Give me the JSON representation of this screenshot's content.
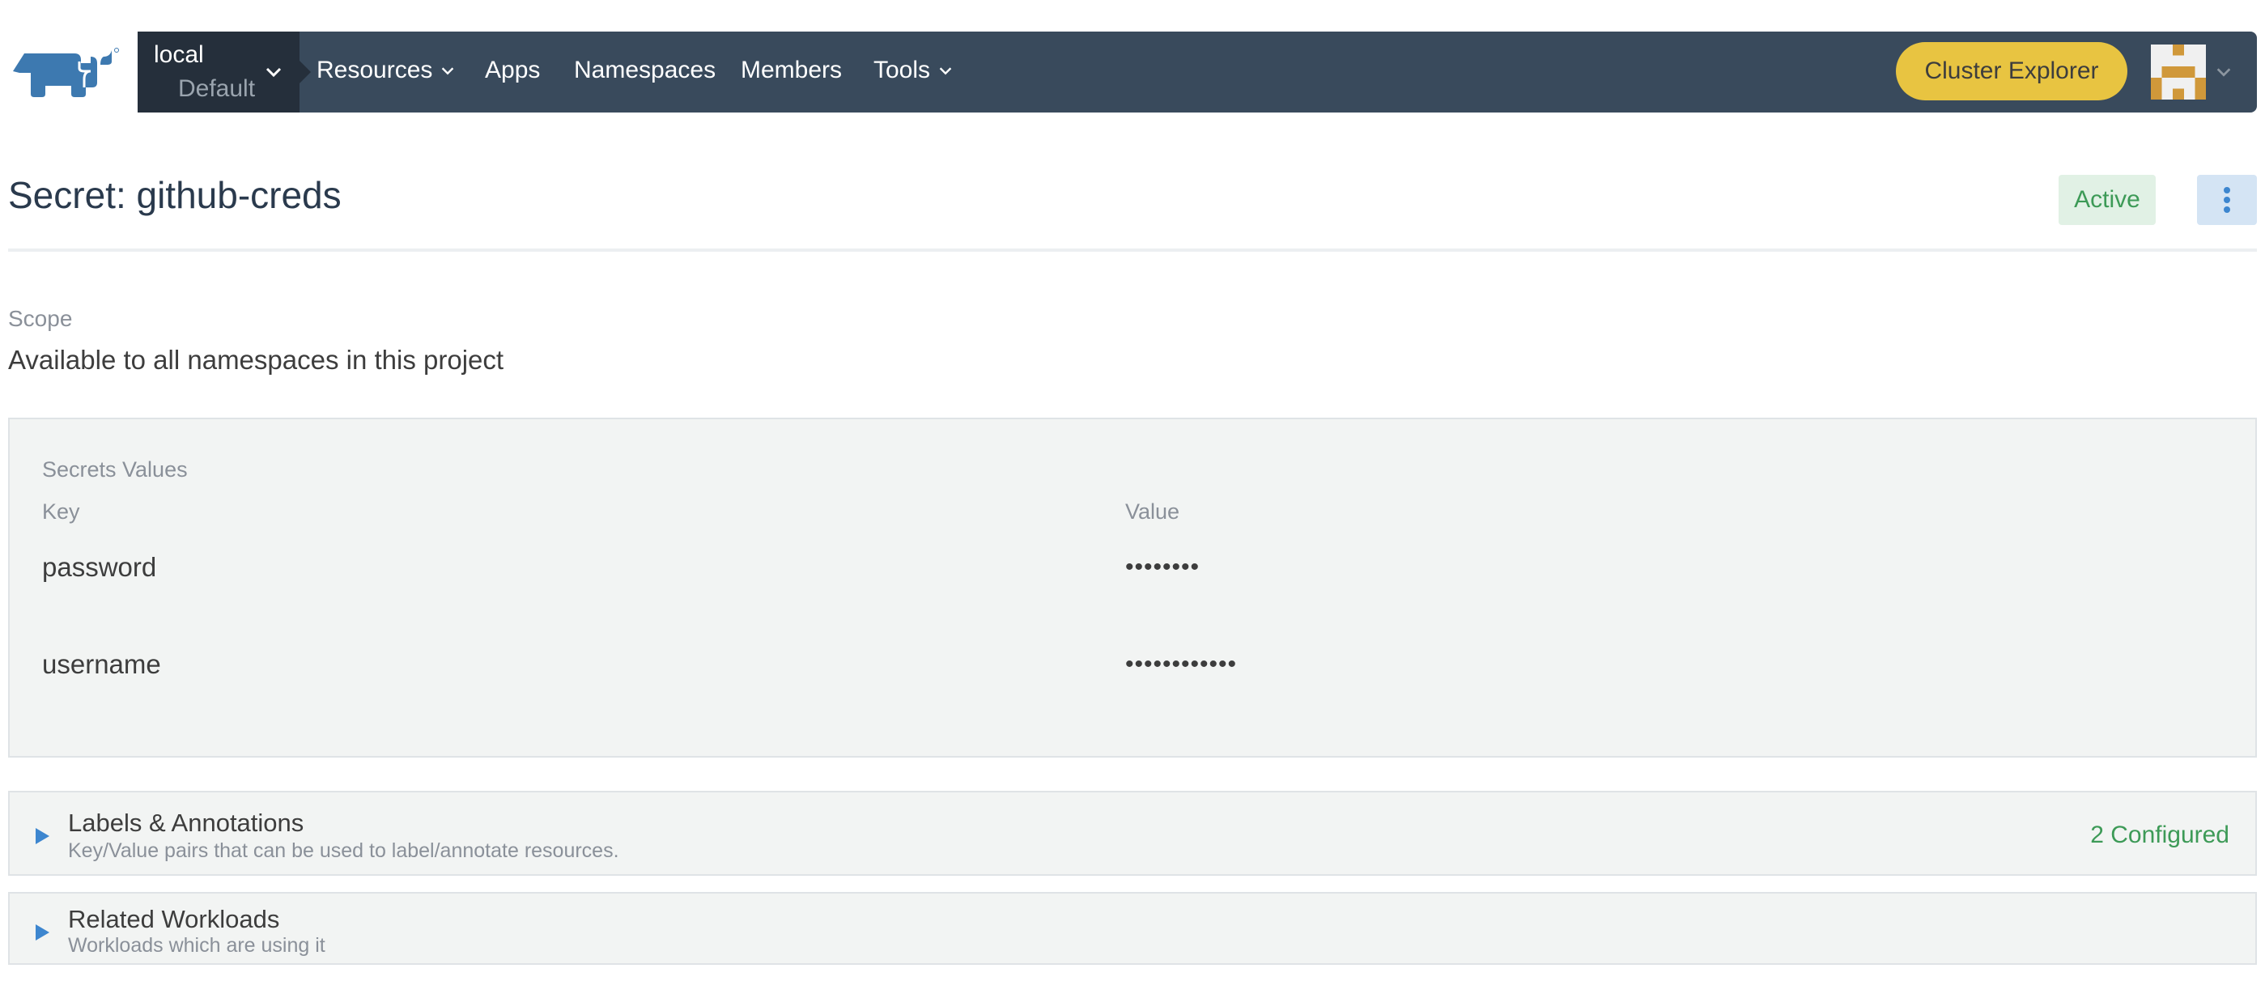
{
  "navbar": {
    "logo": "rancher-logo",
    "cluster": "local",
    "project": "Default",
    "items": [
      {
        "label": "Resources",
        "has_dropdown": true
      },
      {
        "label": "Apps",
        "has_dropdown": false
      },
      {
        "label": "Namespaces",
        "has_dropdown": false
      },
      {
        "label": "Members",
        "has_dropdown": false
      },
      {
        "label": "Tools",
        "has_dropdown": true
      }
    ],
    "cluster_explorer_label": "Cluster Explorer",
    "avatar_icon": "identicon-avatar"
  },
  "header": {
    "title": "Secret: github-creds",
    "status": "Active",
    "actions_icon": "kebab-menu-icon"
  },
  "scope": {
    "label": "Scope",
    "value": "Available to all namespaces in this project"
  },
  "secrets": {
    "title": "Secrets Values",
    "columns": {
      "key": "Key",
      "value": "Value"
    },
    "rows": [
      {
        "key": "password",
        "value": "••••••••"
      },
      {
        "key": "username",
        "value": "••••••••••••"
      }
    ]
  },
  "accordions": [
    {
      "title": "Labels & Annotations",
      "subtitle": "Key/Value pairs that can be used to label/annotate resources.",
      "count": "2 Configured"
    },
    {
      "title": "Related Workloads",
      "subtitle": "Workloads which are using it"
    }
  ],
  "colors": {
    "navbar": "#394a5c",
    "cluster_select": "#252f3b",
    "brand_blue": "#3d79b0",
    "accent_yellow": "#e8c441",
    "status_green": "#3d9a57",
    "panel_bg": "#f2f4f3"
  }
}
